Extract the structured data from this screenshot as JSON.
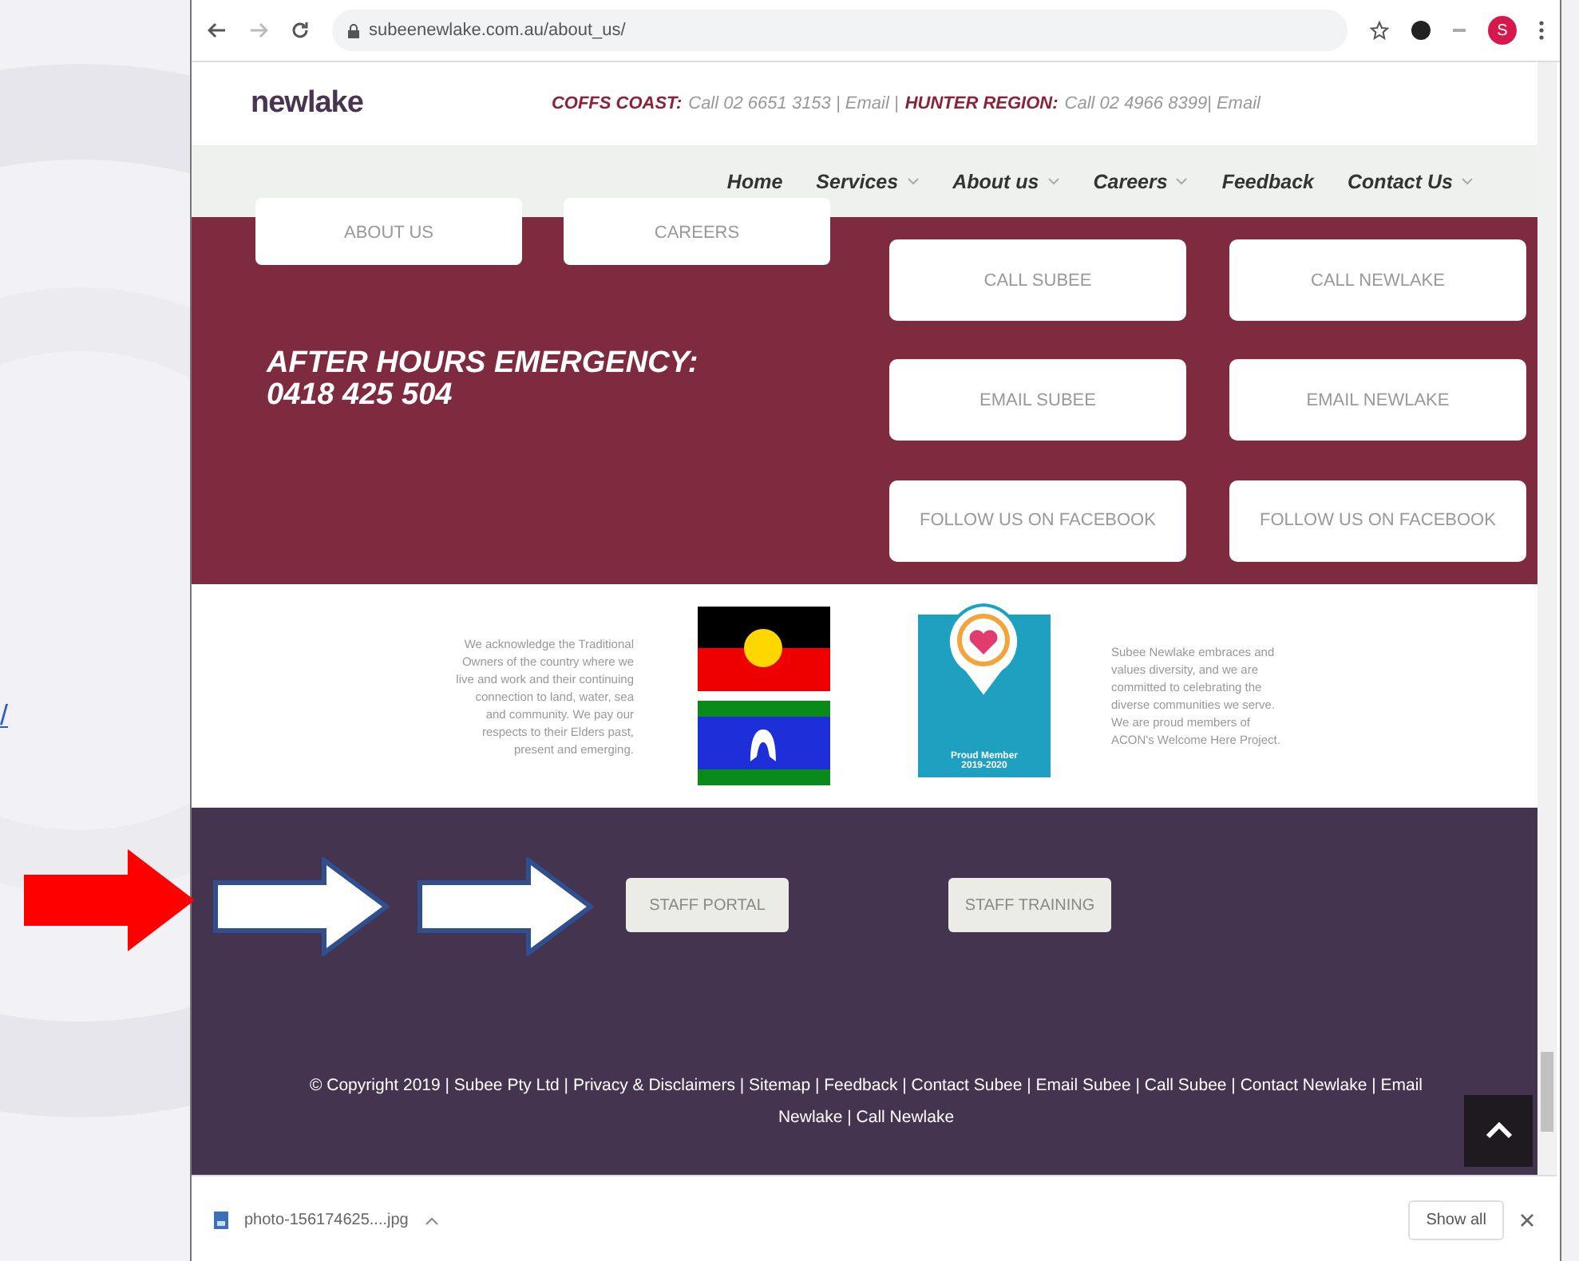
{
  "slide": {
    "link_text": "/"
  },
  "browser": {
    "url": "subeenewlake.com.au/about_us/",
    "profile_initial": "S"
  },
  "header": {
    "logo": "newlake",
    "contact_parts": [
      {
        "kind": "region",
        "text": "COFFS COAST:"
      },
      {
        "kind": "detail",
        "text": "Call 02 6651 3153 | Email |"
      },
      {
        "kind": "region",
        "text": "HUNTER REGION:"
      },
      {
        "kind": "detail",
        "text": "Call 02 4966 8399| Email"
      }
    ]
  },
  "nav": [
    {
      "label": "Home",
      "dropdown": false
    },
    {
      "label": "Services",
      "dropdown": true
    },
    {
      "label": "About us",
      "dropdown": true
    },
    {
      "label": "Careers",
      "dropdown": true
    },
    {
      "label": "Feedback",
      "dropdown": false
    },
    {
      "label": "Contact Us",
      "dropdown": true
    }
  ],
  "quick_links": [
    "ABOUT US",
    "CAREERS"
  ],
  "emergency": {
    "title": "AFTER HOURS EMERGENCY:",
    "phone": "0418 425 504"
  },
  "contact_buttons": [
    "CALL SUBEE",
    "CALL NEWLAKE",
    "EMAIL SUBEE",
    "EMAIL NEWLAKE",
    "FOLLOW US ON FACEBOOK",
    "FOLLOW US ON FACEBOOK"
  ],
  "acknowledgement": "We acknowledge the Traditional Owners of the country where we live and work and their continuing connection to land, water, sea and community. We pay our respects to their Elders past, present and emerging.",
  "badge": {
    "text": "Proud Member",
    "years": "2019-2020"
  },
  "diversity": "Subee Newlake embraces and values diversity, and we are committed to celebrating the diverse communities we serve. We are proud members of ACON's Welcome Here Project.",
  "staff_buttons": [
    "STAFF PORTAL",
    "STAFF TRAINING"
  ],
  "footer": "© Copyright 2019 | Subee Pty Ltd | Privacy & Disclaimers | Sitemap | Feedback | Contact Subee | Email Subee | Call Subee | Contact Newlake | Email Newlake | Call Newlake",
  "download": {
    "file": "photo-156174625....jpg",
    "show_all": "Show all"
  }
}
